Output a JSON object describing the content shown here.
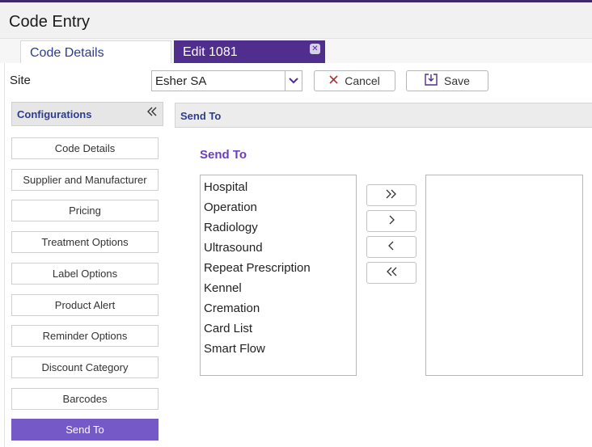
{
  "app": {
    "title": "Code Entry"
  },
  "tabs": [
    {
      "label": "Code Details"
    },
    {
      "label": "Edit 1081"
    }
  ],
  "toolbar": {
    "site_label": "Site",
    "site_value": "Esher SA",
    "cancel_label": "Cancel",
    "save_label": "Save"
  },
  "sidebar": {
    "header": "Configurations",
    "items": [
      {
        "label": "Code Details"
      },
      {
        "label": "Supplier and Manufacturer"
      },
      {
        "label": "Pricing"
      },
      {
        "label": "Treatment Options"
      },
      {
        "label": "Label Options"
      },
      {
        "label": "Product Alert"
      },
      {
        "label": "Reminder Options"
      },
      {
        "label": "Discount Category"
      },
      {
        "label": "Barcodes"
      },
      {
        "label": "Send To"
      }
    ],
    "active_index": 9
  },
  "panel": {
    "header": "Send To",
    "section_title": "Send To",
    "available": [
      "Hospital",
      "Operation",
      "Radiology",
      "Ultrasound",
      "Repeat Prescription",
      "Kennel",
      "Cremation",
      "Card List",
      "Smart Flow"
    ],
    "selected": []
  },
  "icons": {
    "close_tab": "close-icon",
    "dropdown": "chevron-down-icon",
    "cancel": "x-icon",
    "save": "save-icon",
    "collapse": "double-chevron-left-icon",
    "move_all_right": "double-chevron-right-icon",
    "move_right": "chevron-right-icon",
    "move_left": "chevron-left-icon",
    "move_all_left": "double-chevron-left-icon"
  },
  "colors": {
    "accent": "#4f2e8d",
    "active_item": "#7559c6",
    "heading": "#2d3c8f",
    "section_title": "#6a3fbf",
    "cancel_x": "#c62828"
  }
}
